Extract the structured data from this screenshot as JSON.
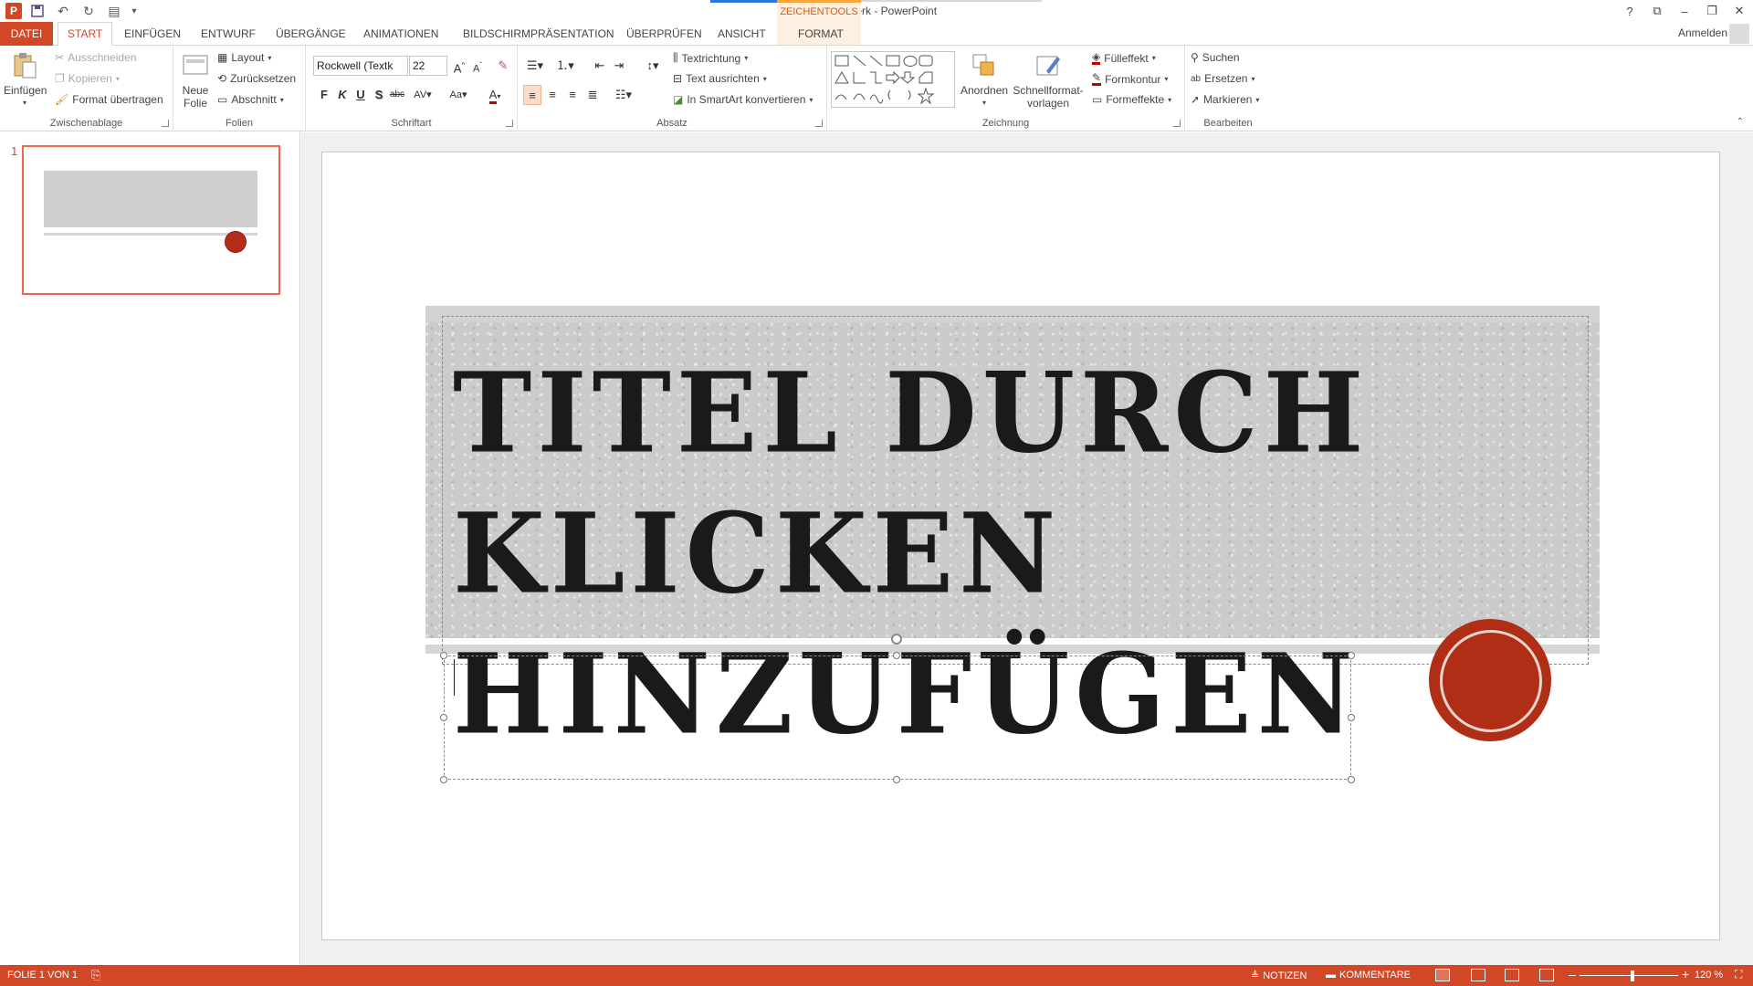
{
  "app": {
    "title": "Lizenzwerk - PowerPoint",
    "account_label": "Anmelden",
    "help_label": "?",
    "context_tools_label": "ZEICHENTOOLS"
  },
  "tabs": [
    {
      "label": "DATEI"
    },
    {
      "label": "START"
    },
    {
      "label": "EINFÜGEN"
    },
    {
      "label": "ENTWURF"
    },
    {
      "label": "ÜBERGÄNGE"
    },
    {
      "label": "ANIMATIONEN"
    },
    {
      "label": "BILDSCHIRMPRÄSENTATION"
    },
    {
      "label": "ÜBERPRÜFEN"
    },
    {
      "label": "ANSICHT"
    },
    {
      "label": "FORMAT"
    }
  ],
  "ribbon": {
    "clipboard": {
      "label": "Zwischenablage",
      "paste": "Einfügen",
      "cut": "Ausschneiden",
      "copy": "Kopieren",
      "format_painter": "Format übertragen"
    },
    "slides": {
      "label": "Folien",
      "new_slide_line1": "Neue",
      "new_slide_line2": "Folie",
      "layout": "Layout",
      "reset": "Zurücksetzen",
      "section": "Abschnitt"
    },
    "font": {
      "label": "Schriftart",
      "font_name": "Rockwell (Textk",
      "font_size": "22",
      "bold": "F",
      "italic": "K",
      "underline": "U",
      "shadow": "S",
      "strike": "abc",
      "spacing": "AV",
      "case": "Aa"
    },
    "paragraph": {
      "label": "Absatz",
      "text_direction": "Textrichtung",
      "align_text": "Text ausrichten",
      "smartart": "In SmartArt konvertieren"
    },
    "drawing": {
      "label": "Zeichnung",
      "arrange": "Anordnen",
      "quick_styles_line1": "Schnellformat-",
      "quick_styles_line2": "vorlagen",
      "fill": "Fülleffekt",
      "outline": "Formkontur",
      "effects": "Formeffekte"
    },
    "editing": {
      "label": "Bearbeiten",
      "find": "Suchen",
      "replace": "Ersetzen",
      "select": "Markieren"
    }
  },
  "thumbnails": [
    {
      "number": "1"
    }
  ],
  "slide": {
    "title": "Titel durch Klicken hinzufügen"
  },
  "statusbar": {
    "slide_info": "FOLIE 1 VON 1",
    "notes": "NOTIZEN",
    "comments": "KOMMENTARE",
    "zoom": "120 %",
    "zoom_percent": 120
  },
  "colors": {
    "accent": "#d24726",
    "seal": "#b02d16",
    "banner": "#cbcbcb"
  }
}
